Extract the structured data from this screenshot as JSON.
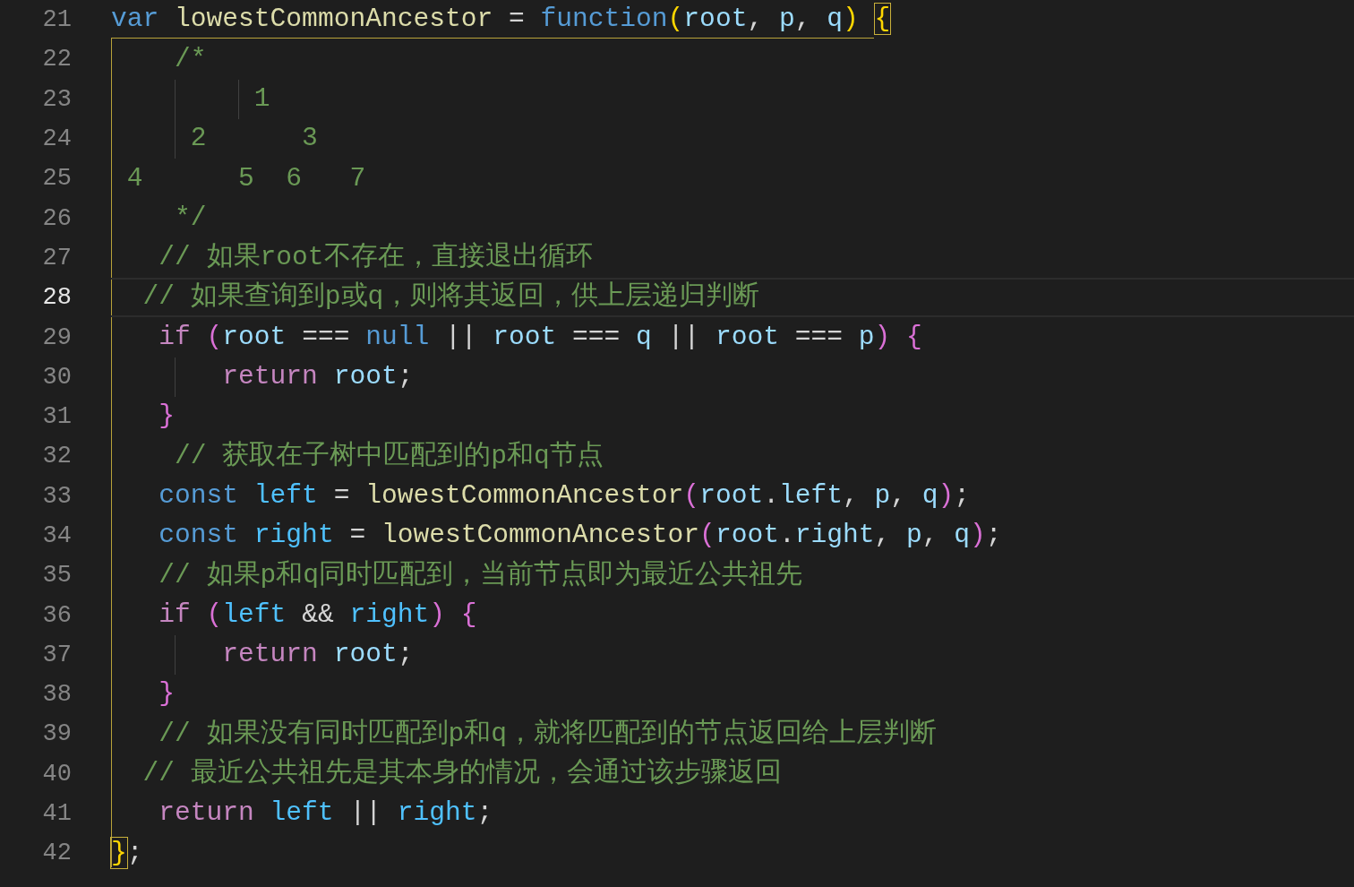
{
  "lines": [
    {
      "number": "21",
      "current": false,
      "tokens": [
        {
          "text": "var ",
          "kind": "kw"
        },
        {
          "text": "lowestCommonAncestor",
          "kind": "fn"
        },
        {
          "text": " = ",
          "kind": "op"
        },
        {
          "text": "function",
          "kind": "kw"
        },
        {
          "text": "(",
          "kind": "b1"
        },
        {
          "text": "root",
          "kind": "var"
        },
        {
          "text": ", ",
          "kind": "op"
        },
        {
          "text": "p",
          "kind": "var"
        },
        {
          "text": ", ",
          "kind": "op"
        },
        {
          "text": "q",
          "kind": "var"
        },
        {
          "text": ") ",
          "kind": "b1"
        },
        {
          "text": "{",
          "kind": "match"
        }
      ]
    },
    {
      "number": "22",
      "current": false,
      "tokens": [
        {
          "text": "    /*",
          "kind": "comment"
        }
      ]
    },
    {
      "number": "23",
      "current": false,
      "tokens": [
        {
          "text": "         1",
          "kind": "comment"
        }
      ]
    },
    {
      "number": "24",
      "current": false,
      "tokens": [
        {
          "text": "     2      3",
          "kind": "comment"
        }
      ]
    },
    {
      "number": "25",
      "current": false,
      "tokens": [
        {
          "text": " 4      5  6   7",
          "kind": "comment"
        }
      ]
    },
    {
      "number": "26",
      "current": false,
      "tokens": [
        {
          "text": "    */",
          "kind": "comment"
        }
      ]
    },
    {
      "number": "27",
      "current": false,
      "tokens": [
        {
          "text": "   // 如果root不存在，直接退出循环",
          "kind": "comment"
        }
      ]
    },
    {
      "number": "28",
      "current": true,
      "tokens": [
        {
          "text": "  // 如果查询到p或q，则将其返回，供上层递归判断",
          "kind": "comment"
        }
      ]
    },
    {
      "number": "29",
      "current": false,
      "tokens": [
        {
          "text": "   if ",
          "kind": "ctrl"
        },
        {
          "text": "(",
          "kind": "b2"
        },
        {
          "text": "root",
          "kind": "var"
        },
        {
          "text": " === ",
          "kind": "op"
        },
        {
          "text": "null",
          "kind": "kw"
        },
        {
          "text": " || ",
          "kind": "op"
        },
        {
          "text": "root",
          "kind": "var"
        },
        {
          "text": " === ",
          "kind": "op"
        },
        {
          "text": "q",
          "kind": "var"
        },
        {
          "text": " || ",
          "kind": "op"
        },
        {
          "text": "root",
          "kind": "var"
        },
        {
          "text": " === ",
          "kind": "op"
        },
        {
          "text": "p",
          "kind": "var"
        },
        {
          "text": ") ",
          "kind": "b2"
        },
        {
          "text": "{",
          "kind": "b2"
        }
      ]
    },
    {
      "number": "30",
      "current": false,
      "tokens": [
        {
          "text": "       return ",
          "kind": "ctrl"
        },
        {
          "text": "root",
          "kind": "var"
        },
        {
          "text": ";",
          "kind": "op"
        }
      ]
    },
    {
      "number": "31",
      "current": false,
      "tokens": [
        {
          "text": "   }",
          "kind": "b2"
        }
      ]
    },
    {
      "number": "32",
      "current": false,
      "tokens": [
        {
          "text": "    // 获取在子树中匹配到的p和q节点",
          "kind": "comment"
        }
      ]
    },
    {
      "number": "33",
      "current": false,
      "tokens": [
        {
          "text": "   const ",
          "kind": "kw"
        },
        {
          "text": "left",
          "kind": "const"
        },
        {
          "text": " = ",
          "kind": "op"
        },
        {
          "text": "lowestCommonAncestor",
          "kind": "fn"
        },
        {
          "text": "(",
          "kind": "b2"
        },
        {
          "text": "root",
          "kind": "var"
        },
        {
          "text": ".",
          "kind": "op"
        },
        {
          "text": "left",
          "kind": "var"
        },
        {
          "text": ", ",
          "kind": "op"
        },
        {
          "text": "p",
          "kind": "var"
        },
        {
          "text": ", ",
          "kind": "op"
        },
        {
          "text": "q",
          "kind": "var"
        },
        {
          "text": ")",
          "kind": "b2"
        },
        {
          "text": ";",
          "kind": "op"
        }
      ]
    },
    {
      "number": "34",
      "current": false,
      "tokens": [
        {
          "text": "   const ",
          "kind": "kw"
        },
        {
          "text": "right",
          "kind": "const"
        },
        {
          "text": " = ",
          "kind": "op"
        },
        {
          "text": "lowestCommonAncestor",
          "kind": "fn"
        },
        {
          "text": "(",
          "kind": "b2"
        },
        {
          "text": "root",
          "kind": "var"
        },
        {
          "text": ".",
          "kind": "op"
        },
        {
          "text": "right",
          "kind": "var"
        },
        {
          "text": ", ",
          "kind": "op"
        },
        {
          "text": "p",
          "kind": "var"
        },
        {
          "text": ", ",
          "kind": "op"
        },
        {
          "text": "q",
          "kind": "var"
        },
        {
          "text": ")",
          "kind": "b2"
        },
        {
          "text": ";",
          "kind": "op"
        }
      ]
    },
    {
      "number": "35",
      "current": false,
      "tokens": [
        {
          "text": "   // 如果p和q同时匹配到，当前节点即为最近公共祖先",
          "kind": "comment"
        }
      ]
    },
    {
      "number": "36",
      "current": false,
      "tokens": [
        {
          "text": "   if ",
          "kind": "ctrl"
        },
        {
          "text": "(",
          "kind": "b2"
        },
        {
          "text": "left",
          "kind": "const"
        },
        {
          "text": " && ",
          "kind": "op"
        },
        {
          "text": "right",
          "kind": "const"
        },
        {
          "text": ") ",
          "kind": "b2"
        },
        {
          "text": "{",
          "kind": "b2"
        }
      ]
    },
    {
      "number": "37",
      "current": false,
      "tokens": [
        {
          "text": "       return ",
          "kind": "ctrl"
        },
        {
          "text": "root",
          "kind": "var"
        },
        {
          "text": ";",
          "kind": "op"
        }
      ]
    },
    {
      "number": "38",
      "current": false,
      "tokens": [
        {
          "text": "   }",
          "kind": "b2"
        }
      ]
    },
    {
      "number": "39",
      "current": false,
      "tokens": [
        {
          "text": "   // 如果没有同时匹配到p和q，就将匹配到的节点返回给上层判断",
          "kind": "comment"
        }
      ]
    },
    {
      "number": "40",
      "current": false,
      "tokens": [
        {
          "text": "  // 最近公共祖先是其本身的情况，会通过该步骤返回",
          "kind": "comment"
        }
      ]
    },
    {
      "number": "41",
      "current": false,
      "tokens": [
        {
          "text": "   return ",
          "kind": "ctrl"
        },
        {
          "text": "left",
          "kind": "const"
        },
        {
          "text": " || ",
          "kind": "op"
        },
        {
          "text": "right",
          "kind": "const"
        },
        {
          "text": ";",
          "kind": "op"
        }
      ]
    },
    {
      "number": "42",
      "current": false,
      "tokens": [
        {
          "text": "}",
          "kind": "match"
        },
        {
          "text": ";",
          "kind": "op"
        }
      ]
    }
  ]
}
